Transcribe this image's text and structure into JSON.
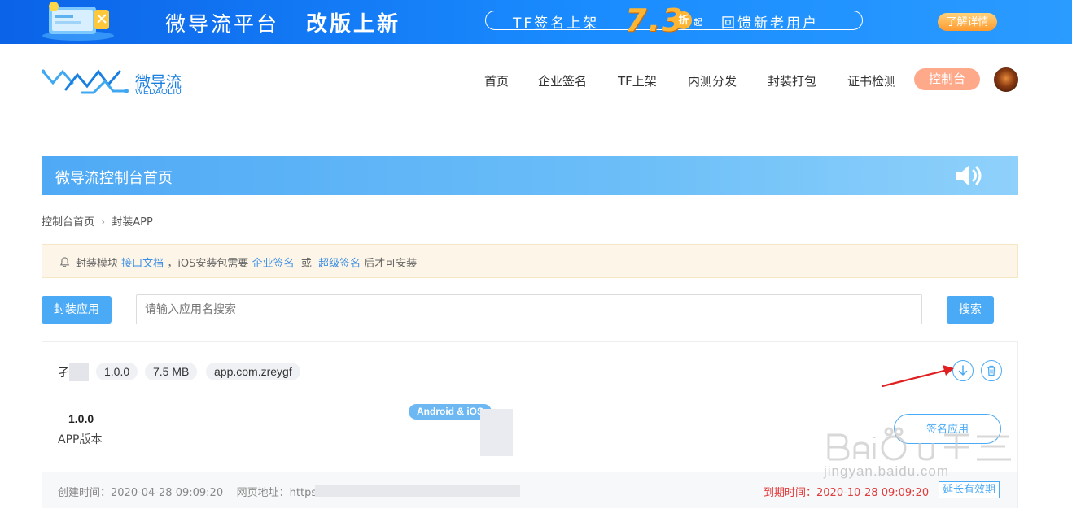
{
  "promo": {
    "title": "微导流平台",
    "title2": "改版上新",
    "pill_left": "TF签名上架",
    "discount": "7.3",
    "zhe": "折",
    "qi": "起",
    "pill_right": "回馈新老用户",
    "button": "了解详情"
  },
  "brand": {
    "name_cn": "微导流",
    "name_en": "WEDAOLIU"
  },
  "nav": {
    "items": [
      "首页",
      "企业签名",
      "TF上架",
      "内测分发",
      "封装打包",
      "证书检测"
    ],
    "console": "控制台"
  },
  "titlebar": {
    "title": "微导流控制台首页"
  },
  "breadcrumb": {
    "home": "控制台首页",
    "sep": "›",
    "current": "封装APP"
  },
  "notice": {
    "prefix": "封装模块",
    "link_docs": "接口文档",
    "middle": "，iOS安装包需要",
    "link_enterprise": "企业签名",
    "or": "或",
    "link_super": "超级签名",
    "suffix": "后才可安装"
  },
  "toolbar": {
    "pack_button": "封装应用",
    "search_placeholder": "请输入应用名搜索",
    "search_button": "搜索"
  },
  "app": {
    "name_char": "孑",
    "version_tag": "1.0.0",
    "size_tag": "7.5 MB",
    "bundle_tag": "app.com.zreygf",
    "version_value": "1.0.0",
    "version_label": "APP版本",
    "platform": "Android & iOS",
    "manage_button": "签名应用",
    "created_label": "创建时间：",
    "created_value": "2020-04-28 09:09:20",
    "url_label": "网页地址：",
    "url_value": "https:",
    "expire_label": "到期时间：",
    "expire_value": "2020-10-28 09:09:20",
    "extend_button": "延长有效期"
  },
  "watermark": {
    "text": "jingyan.baidu.com"
  },
  "colors": {
    "accent": "#4aaaf5",
    "console_button": "#ffa98b",
    "expire_red": "#e23b3b",
    "notice_bg": "#fdf6e8"
  }
}
